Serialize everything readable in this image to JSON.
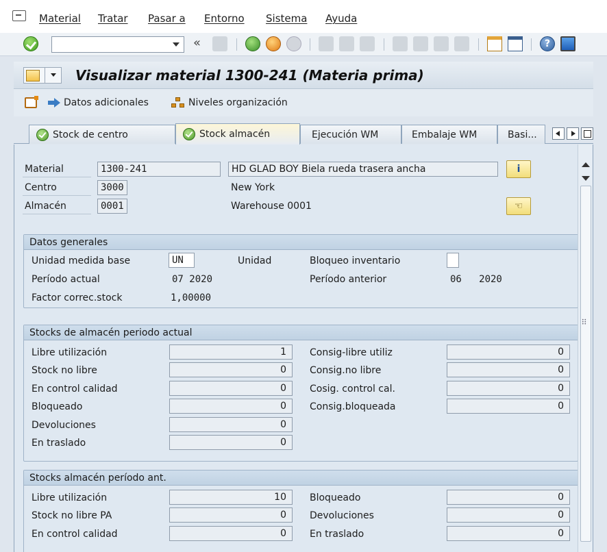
{
  "menu": {
    "items": [
      "Material",
      "Tratar",
      "Pasar a",
      "Entorno",
      "Sistema",
      "Ayuda"
    ]
  },
  "toolbar": {
    "command_value": "",
    "icons": [
      "enter-icon",
      "back-icon",
      "save-icon",
      "back-green-icon",
      "exit-icon",
      "cancel-icon",
      "print-icon",
      "find-icon",
      "find-next-icon",
      "first-page-icon",
      "prev-page-icon",
      "next-page-icon",
      "last-page-icon",
      "create-session-icon",
      "shortcut-icon",
      "help-icon",
      "layout-icon"
    ]
  },
  "title": {
    "text": "Visualizar material 1300-241 (Materia prima)"
  },
  "app_toolbar": {
    "additional_data": "Datos adicionales",
    "org_levels": "Niveles organización"
  },
  "tabs": [
    {
      "label": "Stock de centro",
      "active": false,
      "icon": "check-icon"
    },
    {
      "label": "Stock almacén",
      "active": true,
      "icon": "check-icon"
    },
    {
      "label": "Ejecución WM",
      "active": false
    },
    {
      "label": "Embalaje WM",
      "active": false
    },
    {
      "label": "Basi...",
      "active": false
    }
  ],
  "header_fields": {
    "material_label": "Material",
    "material_value": "1300-241",
    "material_desc": "HD GLAD BOY Biela rueda trasera ancha",
    "centro_label": "Centro",
    "centro_value": "3000",
    "centro_desc": "New York",
    "almacen_label": "Almacén",
    "almacen_value": "0001",
    "almacen_desc": "Warehouse 0001"
  },
  "datos_generales": {
    "title": "Datos generales",
    "unidad_label": "Unidad medida base",
    "unidad_value": "UN",
    "unidad_desc": "Unidad",
    "bloqueo_label": "Bloqueo inventario",
    "periodo_actual_label": "Período actual",
    "periodo_actual_value": "07 2020",
    "periodo_anterior_label": "Período anterior",
    "periodo_anterior_value": "06   2020",
    "factor_label": "Factor correc.stock",
    "factor_value": "1,00000"
  },
  "stocks_actual": {
    "title": "Stocks de almacén periodo actual",
    "left": [
      {
        "label": "Libre utilización",
        "value": "1"
      },
      {
        "label": "Stock no libre",
        "value": "0"
      },
      {
        "label": "En control calidad",
        "value": "0"
      },
      {
        "label": "Bloqueado",
        "value": "0"
      },
      {
        "label": "Devoluciones",
        "value": "0"
      },
      {
        "label": "En traslado",
        "value": "0"
      }
    ],
    "right": [
      {
        "label": "Consig-libre utiliz",
        "value": "0"
      },
      {
        "label": "Consig.no libre",
        "value": "0"
      },
      {
        "label": "Cosig. control cal.",
        "value": "0"
      },
      {
        "label": "Consig.bloqueada",
        "value": "0"
      }
    ]
  },
  "stocks_anterior": {
    "title": "Stocks almacén período ant.",
    "left": [
      {
        "label": "Libre utilización",
        "value": "10"
      },
      {
        "label": "Stock no libre PA",
        "value": "0"
      },
      {
        "label": "En control calidad",
        "value": "0"
      }
    ],
    "right": [
      {
        "label": "Bloqueado",
        "value": "0"
      },
      {
        "label": "Devoluciones",
        "value": "0"
      },
      {
        "label": "En traslado",
        "value": "0"
      }
    ]
  }
}
